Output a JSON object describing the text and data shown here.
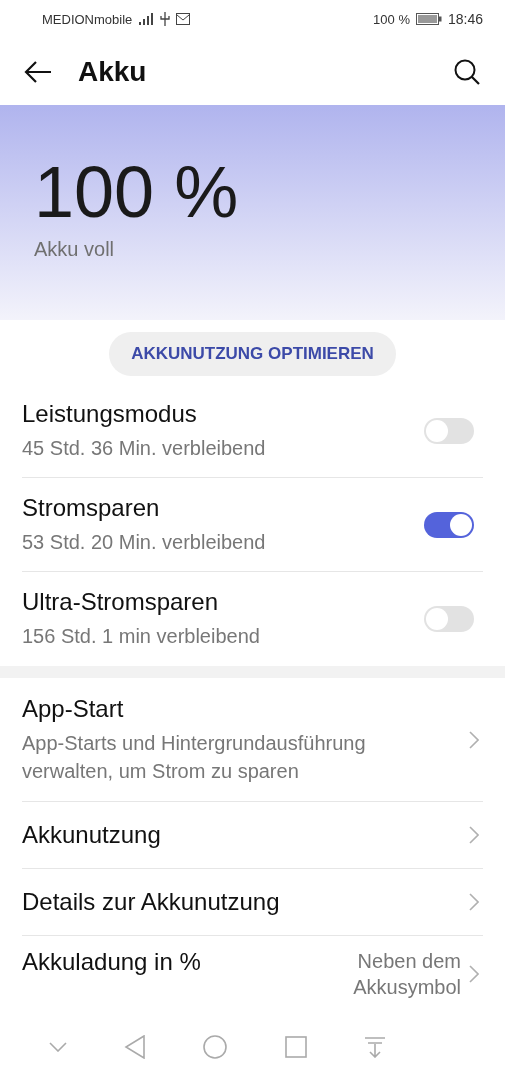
{
  "status_bar": {
    "carrier": "MEDIONmobile",
    "battery_text": "100 %",
    "time": "18:46"
  },
  "header": {
    "title": "Akku"
  },
  "hero": {
    "percent": "100 %",
    "status": "Akku voll"
  },
  "optimize_button": "AKKUNUTZUNG OPTIMIEREN",
  "toggles": [
    {
      "title": "Leistungsmodus",
      "subtitle": "45 Std. 36 Min. verbleibend",
      "on": false
    },
    {
      "title": "Stromsparen",
      "subtitle": "53 Std. 20 Min. verbleibend",
      "on": true
    },
    {
      "title": "Ultra-Stromsparen",
      "subtitle": "156 Std. 1 min verbleibend",
      "on": false
    }
  ],
  "links": [
    {
      "title": "App-Start",
      "subtitle": "App-Starts und Hintergrundausführung verwalten, um Strom zu sparen"
    },
    {
      "title": "Akkunutzung"
    },
    {
      "title": "Details zur Akkunutzung"
    },
    {
      "title": "Akkuladung in %",
      "value": "Neben dem Akkusymbol"
    }
  ]
}
